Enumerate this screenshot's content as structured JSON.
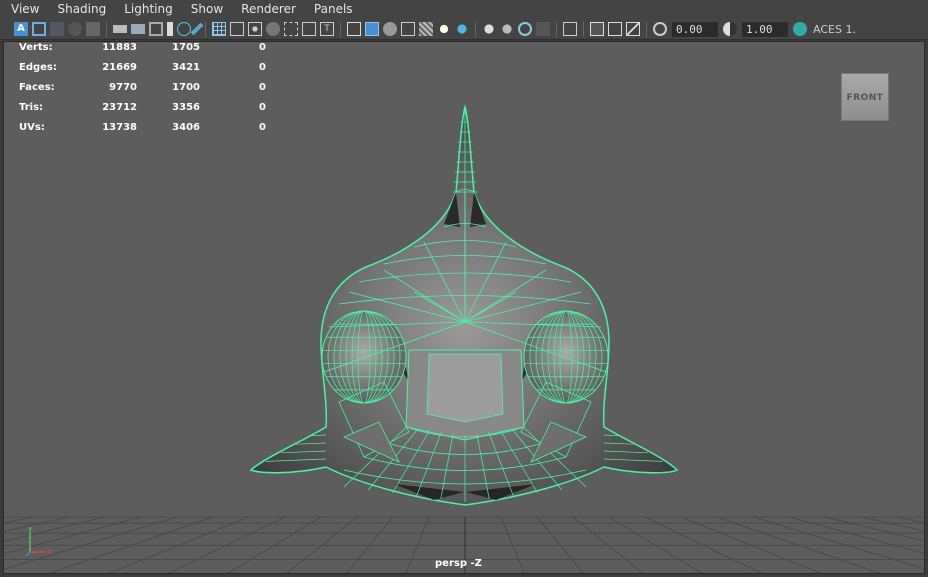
{
  "menu": [
    "View",
    "Shading",
    "Lighting",
    "Show",
    "Renderer",
    "Panels"
  ],
  "toolbar": {
    "exposure_value": "0.00",
    "gamma_value": "1.00",
    "color_space": "ACES 1."
  },
  "hud": {
    "rows": [
      {
        "label": "Verts:",
        "v1": "11883",
        "v2": "1705",
        "v3": "0"
      },
      {
        "label": "Edges:",
        "v1": "21669",
        "v2": "3421",
        "v3": "0"
      },
      {
        "label": "Faces:",
        "v1": "9770",
        "v2": "1700",
        "v3": "0"
      },
      {
        "label": "Tris:",
        "v1": "23712",
        "v2": "3356",
        "v3": "0"
      },
      {
        "label": "UVs:",
        "v1": "13738",
        "v2": "3406",
        "v3": "0"
      }
    ]
  },
  "viewcube_label": "FRONT",
  "camera_label": "persp -Z",
  "axis": {
    "y": "Y",
    "x": "X"
  },
  "colors": {
    "wireframe": "#4cf2a4",
    "viewport_bg": "#5d5d5d",
    "grid": "#4a4a4a"
  }
}
